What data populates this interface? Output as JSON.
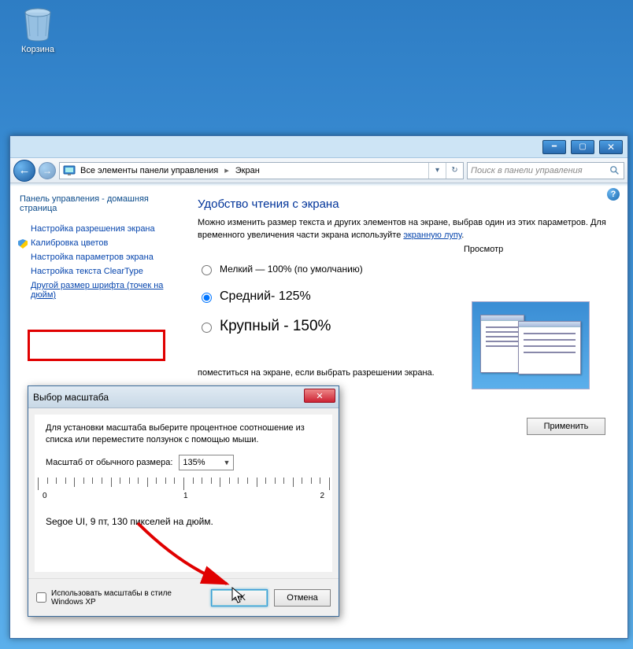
{
  "desktop": {
    "recycle_bin_label": "Корзина"
  },
  "window": {
    "breadcrumb": {
      "item1": "Все элементы панели управления",
      "item2": "Экран"
    },
    "search_placeholder": "Поиск в панели управления"
  },
  "sidebar": {
    "home": "Панель управления - домашняя страница",
    "links": [
      "Настройка разрешения экрана",
      "Калибровка цветов",
      "Настройка параметров экрана",
      "Настройка текста ClearType",
      "Другой размер шрифта (точек на дюйм)"
    ]
  },
  "main": {
    "heading": "Удобство чтения с экрана",
    "desc_1": "Можно изменить размер текста и других элементов на экране, выбрав один из этих параметров. Для временного увеличения части экрана используйте ",
    "desc_link": "экранную лупу",
    "radio_small": "Мелкий — 100% (по умолчанию)",
    "radio_medium": "Средний- 125%",
    "radio_large": "Крупный - 150%",
    "preview_caption": "Просмотр",
    "note": "поместиться на экране, если выбрать разрешении экрана.",
    "apply": "Применить"
  },
  "dialog": {
    "title": "Выбор масштаба",
    "instruction": "Для установки масштаба выберите процентное соотношение из списка или переместите ползунок с помощью мыши.",
    "scale_label": "Масштаб от обычного размера:",
    "scale_value": "135%",
    "ruler": {
      "l0": "0",
      "l1": "1",
      "l2": "2"
    },
    "font_sample": "Segoe UI, 9 пт, 130 пикселей на дюйм.",
    "xp_check": "Использовать масштабы в стиле Windows XP",
    "ok": "OK",
    "cancel": "Отмена"
  }
}
